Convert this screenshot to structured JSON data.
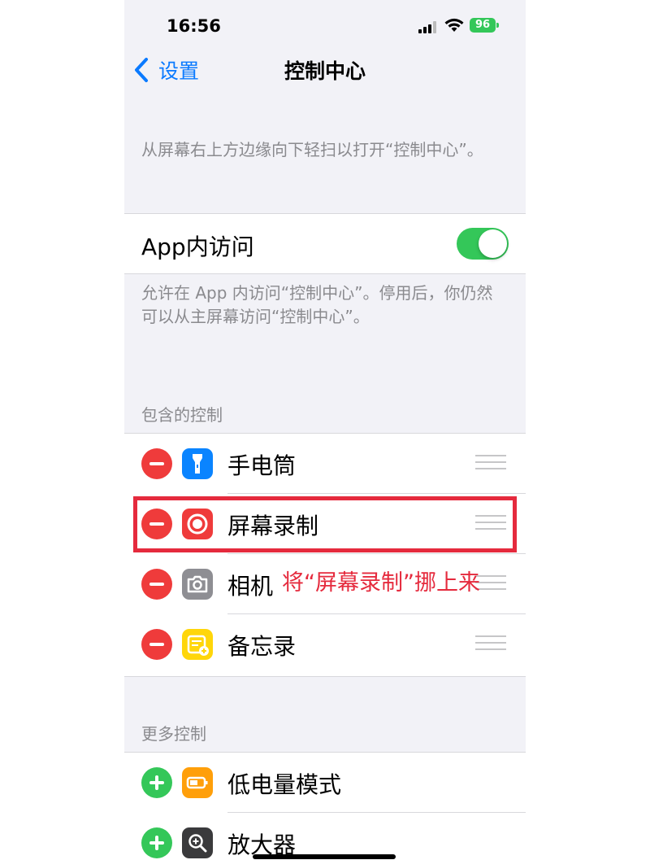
{
  "status_bar": {
    "time": "16:56",
    "battery": "96"
  },
  "nav": {
    "back_label": "设置",
    "title": "控制中心"
  },
  "intro_text": "从屏幕右上方边缘向下轻扫以打开“控制中心”。",
  "app_access": {
    "label": "App内访问",
    "enabled": true
  },
  "app_access_footer": "允许在 App 内访问“控制中心”。停用后，你仍然可以从主屏幕访问“控制中心”。",
  "included_header": "包含的控制",
  "included_controls": [
    {
      "label": "手电筒",
      "icon": "flashlight-icon",
      "color": "#0a84ff"
    },
    {
      "label": "屏幕录制",
      "icon": "screen-record-icon",
      "color": "#ef3b3b"
    },
    {
      "label": "相机",
      "icon": "camera-icon",
      "color": "#8e8e93"
    },
    {
      "label": "备忘录",
      "icon": "notes-icon",
      "color": "#ffd60a"
    }
  ],
  "more_header": "更多控制",
  "more_controls": [
    {
      "label": "低电量模式",
      "icon": "low-power-icon",
      "color": "#ff9f0a"
    },
    {
      "label": "放大器",
      "icon": "magnifier-icon",
      "color": "#3a3a3c"
    }
  ],
  "annotation": "将“屏幕录制”挪上来",
  "colors": {
    "accent": "#0a7aff",
    "remove": "#ef3b3b",
    "add": "#34c759",
    "annotation": "#e52a3d"
  }
}
